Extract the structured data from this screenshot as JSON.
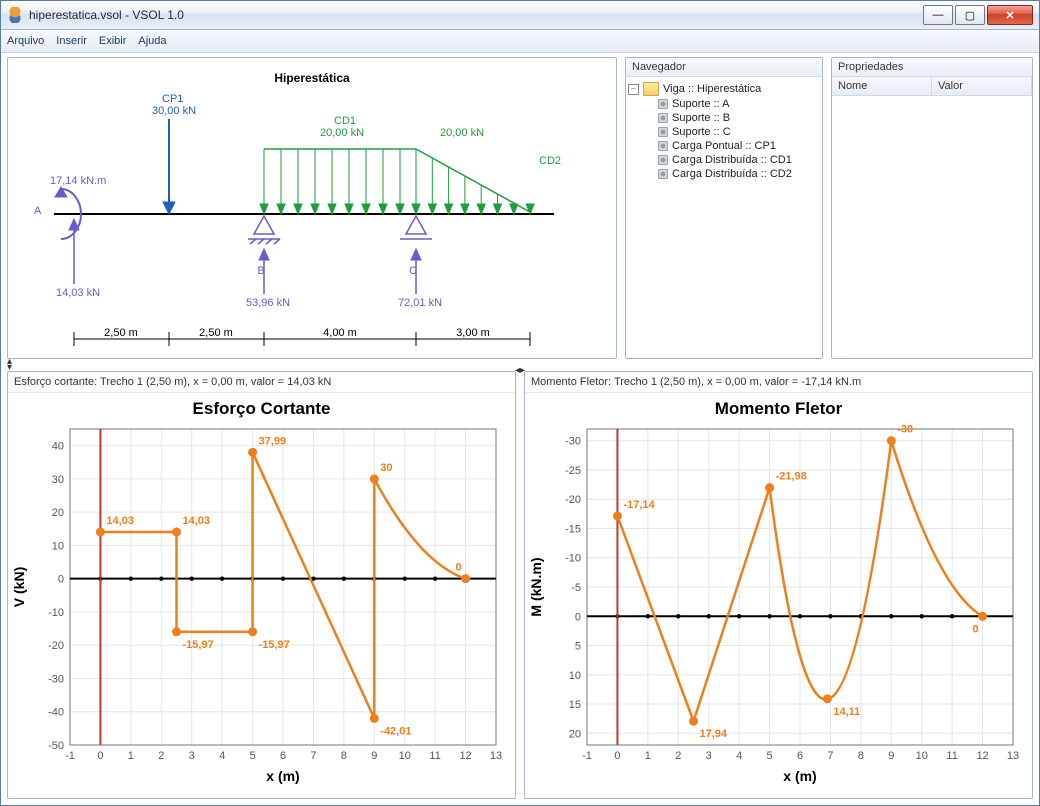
{
  "window": {
    "title": "hiperestatica.vsol - VSOL 1.0"
  },
  "menu": {
    "arquivo": "Arquivo",
    "inserir": "Inserir",
    "exibir": "Exibir",
    "ajuda": "Ajuda"
  },
  "nav": {
    "title": "Navegador",
    "root": "Viga :: Hiperestática",
    "items": [
      "Suporte :: A",
      "Suporte :: B",
      "Suporte :: C",
      "Carga Pontual :: CP1",
      "Carga Distribuída :: CD1",
      "Carga Distribuída :: CD2"
    ]
  },
  "props": {
    "title": "Propriedades",
    "col_name": "Nome",
    "col_value": "Valor"
  },
  "beam": {
    "title": "Hiperestática",
    "cp1_name": "CP1",
    "cp1_val": "30,00 kN",
    "cd1_name": "CD1",
    "cd1_val": "20,00 kN",
    "cd1_val2": "20,00 kN",
    "cd2_name": "CD2",
    "moment": "17,14 kN.m",
    "ra": "14,03 kN",
    "rb": "53,96 kN",
    "rc": "72,01 kN",
    "sa": "A",
    "sb": "B",
    "sc": "C",
    "span1": "2,50 m",
    "span2": "2,50 m",
    "span3": "4,00 m",
    "span4": "3,00 m"
  },
  "shear": {
    "status": "Esforço cortante:  Trecho 1 (2,50 m), x = 0,00 m, valor = 14,03 kN",
    "title": "Esforço Cortante",
    "xlabel": "x (m)",
    "ylabel": "V (kN)"
  },
  "moment": {
    "status": "Momento Fletor:  Trecho 1 (2,50 m), x = 0,00 m, valor = -17,14 kN.m",
    "title": "Momento Fletor",
    "xlabel": "x (m)",
    "ylabel": "M (kN.m)"
  },
  "chart_data": [
    {
      "type": "line",
      "title": "Esforço Cortante",
      "xlabel": "x (m)",
      "ylabel": "V (kN)",
      "xlim": [
        -1,
        13
      ],
      "ylim": [
        -50,
        45
      ],
      "xticks": [
        -1,
        0,
        1,
        2,
        3,
        4,
        5,
        6,
        7,
        8,
        9,
        10,
        11,
        12,
        13
      ],
      "yticks": [
        -50,
        -40,
        -30,
        -20,
        -10,
        0,
        10,
        20,
        30,
        40
      ],
      "segments": [
        {
          "x": [
            0,
            2.5
          ],
          "y": [
            14.03,
            14.03
          ]
        },
        {
          "x": [
            2.5,
            2.5
          ],
          "y": [
            14.03,
            -15.97
          ]
        },
        {
          "x": [
            2.5,
            5
          ],
          "y": [
            -15.97,
            -15.97
          ]
        },
        {
          "x": [
            5,
            5
          ],
          "y": [
            -15.97,
            37.99
          ]
        },
        {
          "x": [
            5,
            9
          ],
          "y": [
            37.99,
            -42.01
          ]
        },
        {
          "x": [
            9,
            9
          ],
          "y": [
            -42.01,
            30
          ]
        },
        {
          "x": [
            9,
            12
          ],
          "y": [
            30,
            0
          ],
          "curve": true
        }
      ],
      "markers": [
        {
          "x": 0,
          "y": 14.03,
          "label": "14,03"
        },
        {
          "x": 2.5,
          "y": 14.03,
          "label": "14,03"
        },
        {
          "x": 2.5,
          "y": -15.97,
          "label": "-15,97"
        },
        {
          "x": 5,
          "y": -15.97,
          "label": "-15,97"
        },
        {
          "x": 5,
          "y": 37.99,
          "label": "37,99"
        },
        {
          "x": 9,
          "y": -42.01,
          "label": "-42,01"
        },
        {
          "x": 9,
          "y": 30,
          "label": "30"
        },
        {
          "x": 12,
          "y": 0,
          "label": "0"
        }
      ]
    },
    {
      "type": "line",
      "title": "Momento Fletor",
      "xlabel": "x (m)",
      "ylabel": "M (kN.m)",
      "xlim": [
        -1,
        13
      ],
      "ylim_display": [
        -32,
        22
      ],
      "xticks": [
        -1,
        0,
        1,
        2,
        3,
        4,
        5,
        6,
        7,
        8,
        9,
        10,
        11,
        12,
        13
      ],
      "yticks": [
        -30,
        -25,
        -20,
        -15,
        -10,
        -5,
        0,
        5,
        10,
        15,
        20
      ],
      "segments": [
        {
          "x": [
            0,
            2.5
          ],
          "y": [
            -17.14,
            17.94
          ]
        },
        {
          "x": [
            2.5,
            5
          ],
          "y": [
            17.94,
            -21.98
          ]
        },
        {
          "x": [
            5,
            6.9,
            9
          ],
          "y": [
            -21.98,
            14.11,
            -30
          ],
          "para": true
        },
        {
          "x": [
            9,
            12
          ],
          "y": [
            -30,
            0
          ],
          "curve": true
        }
      ],
      "markers": [
        {
          "x": 0,
          "y": -17.14,
          "label": "-17,14"
        },
        {
          "x": 2.5,
          "y": 17.94,
          "label": "17,94"
        },
        {
          "x": 5,
          "y": -21.98,
          "label": "-21,98"
        },
        {
          "x": 6.9,
          "y": 14.11,
          "label": "14,11"
        },
        {
          "x": 9,
          "y": -30,
          "label": "-30"
        },
        {
          "x": 12,
          "y": 0,
          "label": "0"
        }
      ]
    }
  ]
}
